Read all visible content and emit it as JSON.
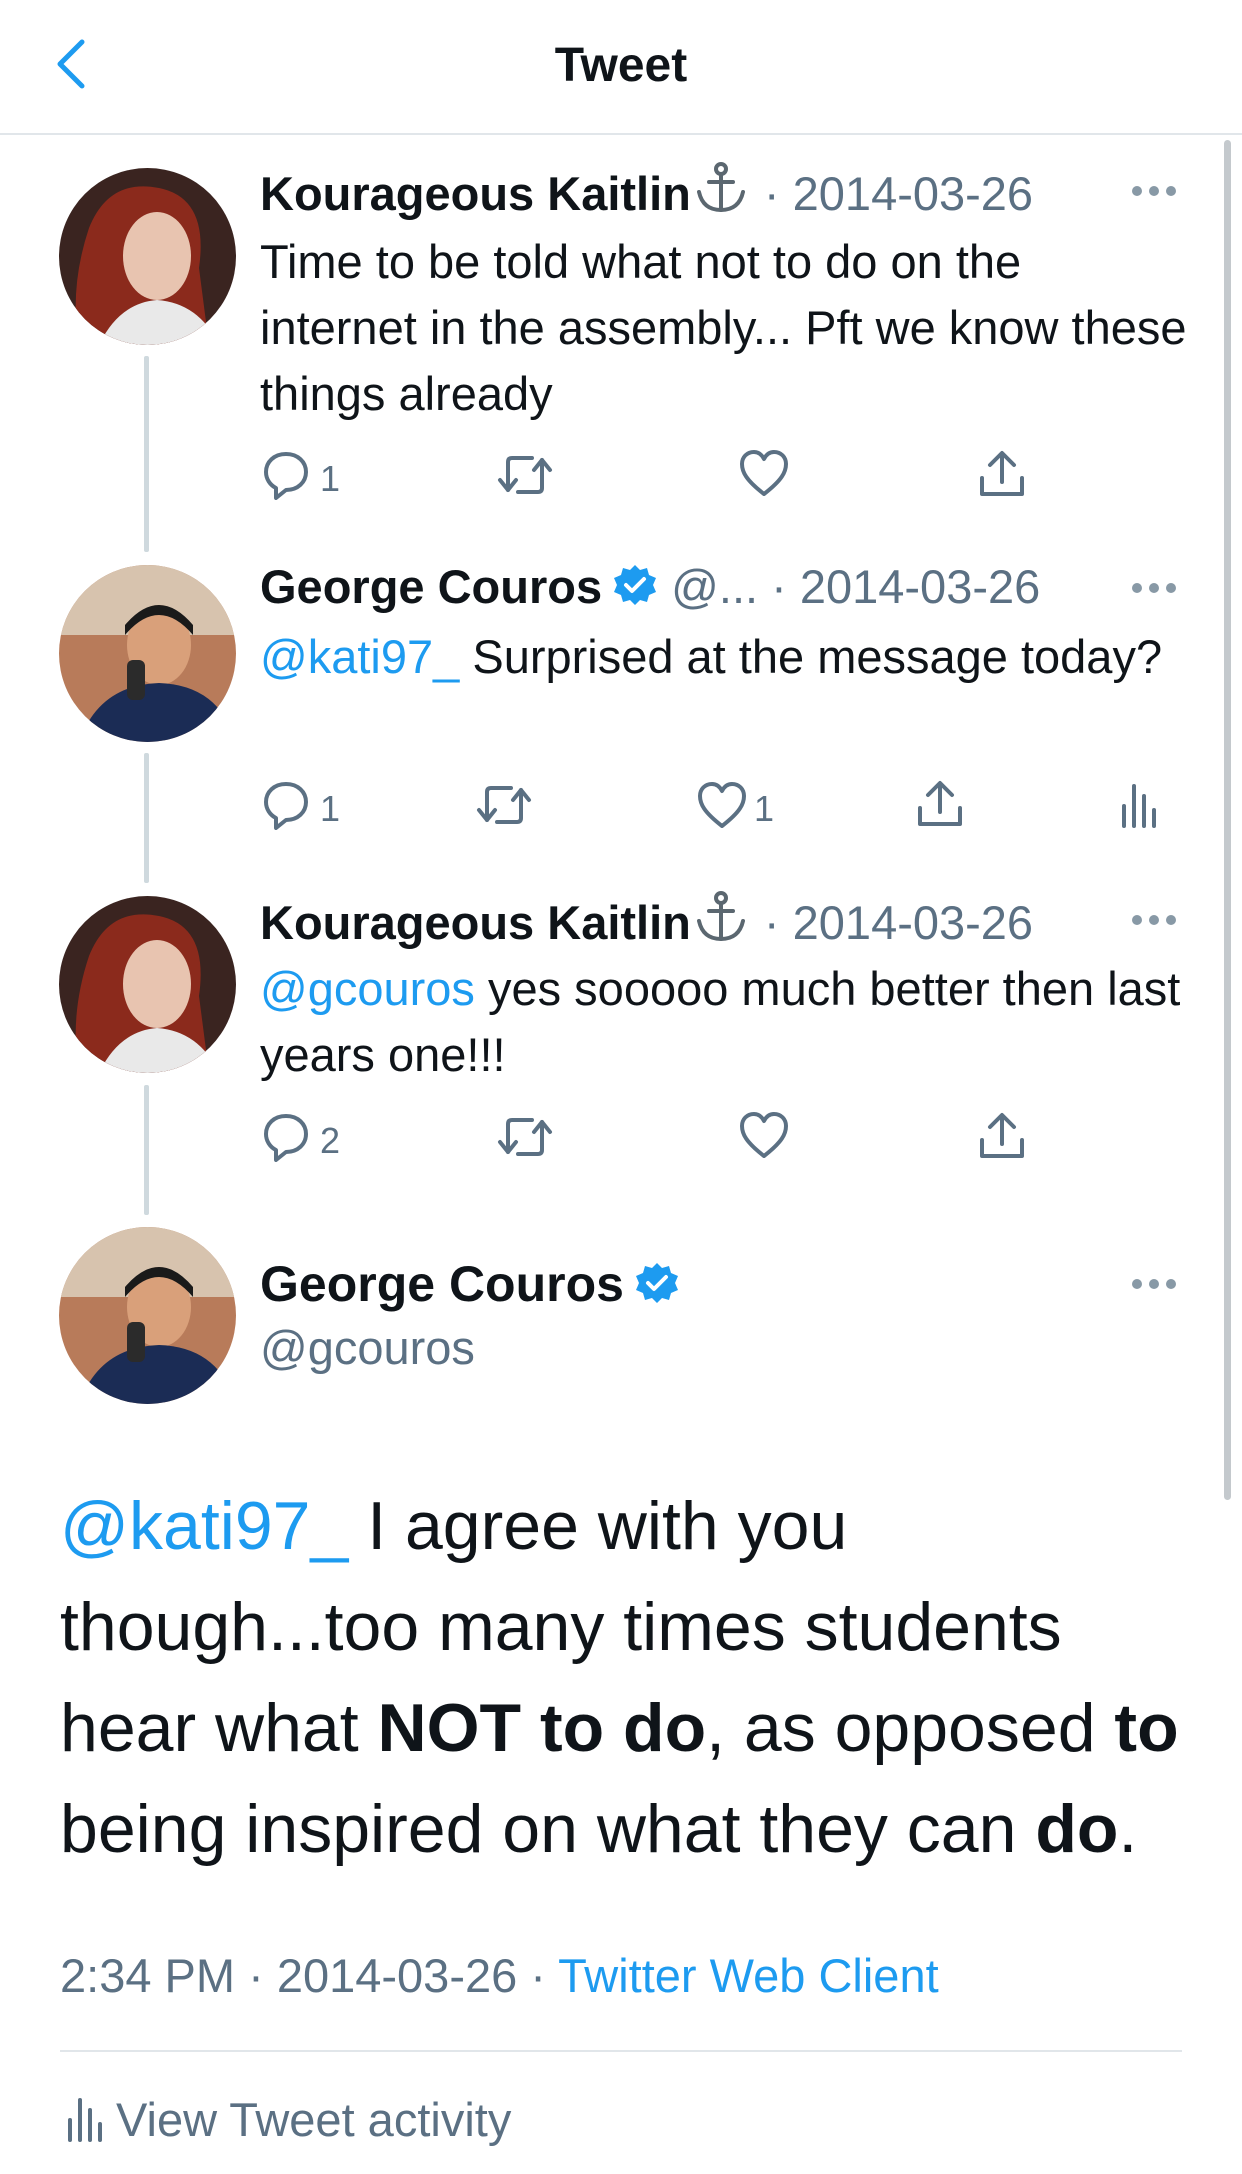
{
  "header": {
    "title": "Tweet"
  },
  "tweets": [
    {
      "name": "Kourageous Kaitlin",
      "name_emoji": "⚓",
      "date": "2014-03-26",
      "text": "Time to be told what not to do on the internet in the assembly... Pft we know these things already",
      "reply_count": "1"
    },
    {
      "name": "George Couros",
      "handle_short": "@...",
      "date": "2014-03-26",
      "mention": "@kati97_",
      "text": " Surprised at the message today?",
      "reply_count": "1",
      "like_count": "1"
    },
    {
      "name": "Kourageous Kaitlin",
      "name_emoji": "⚓",
      "date": "2014-03-26",
      "mention": "@gcouros",
      "text": " yes sooooo much better then last years one!!!",
      "reply_count": "2"
    }
  ],
  "main_tweet": {
    "name": "George Couros",
    "handle": "@gcouros",
    "text_parts": {
      "mention": "@kati97_",
      "t1": " I agree with you though...too many times students hear what ",
      "b1": "NOT to do",
      "t2": ", as opposed ",
      "b2": "to",
      "t3": " being inspired on what they can ",
      "b3": "do",
      "t4": "."
    },
    "time": "2:34 PM",
    "date": "2014-03-26",
    "source": "Twitter Web Client",
    "activity_label": "View Tweet activity"
  },
  "colors": {
    "accent": "#1d9bf0",
    "secondary_text": "#5b7083",
    "verified": "#1d9bf0"
  }
}
